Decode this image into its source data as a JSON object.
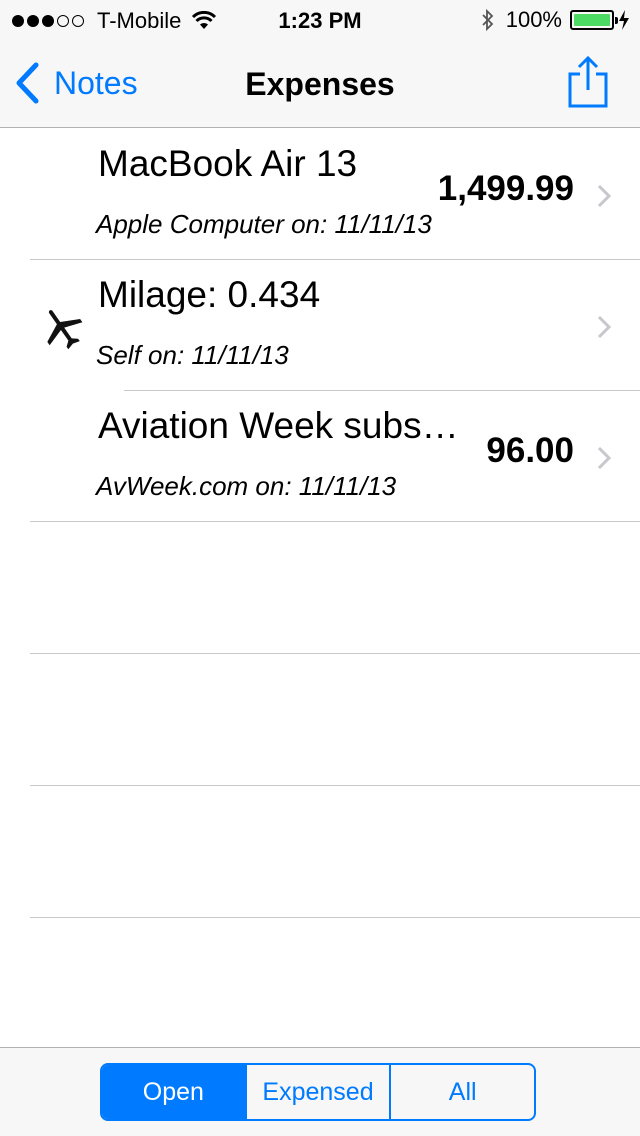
{
  "status": {
    "carrier": "T-Mobile",
    "signal_filled": 3,
    "signal_total": 5,
    "time": "1:23 PM",
    "battery": "100%",
    "battery_fraction": 1.0
  },
  "nav": {
    "back_label": "Notes",
    "title": "Expenses",
    "share_icon": "share-icon"
  },
  "expenses": [
    {
      "title": "MacBook Air 13",
      "subtitle": "Apple Computer on: 11/11/13",
      "amount": "1,499.99",
      "icon": ""
    },
    {
      "title": "Milage: 0.434",
      "subtitle": "Self on: 11/11/13",
      "amount": "",
      "icon": "airplane-icon"
    },
    {
      "title": "Aviation Week subs…",
      "subtitle": "AvWeek.com on: 11/11/13",
      "amount": "96.00",
      "icon": ""
    }
  ],
  "filter": {
    "segments": [
      "Open",
      "Expensed",
      "All"
    ],
    "selected": "Open"
  },
  "colors": {
    "accent": "#007aff",
    "battery": "#4cd964"
  }
}
